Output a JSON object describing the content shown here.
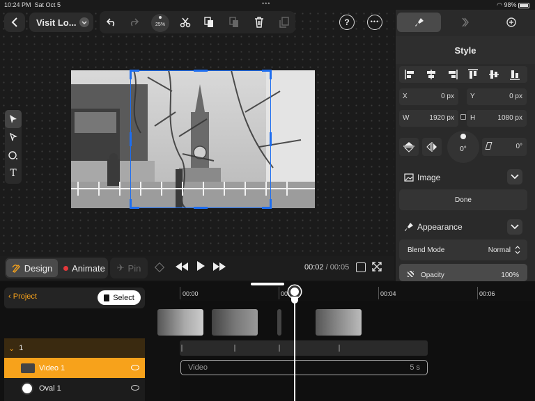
{
  "status_bar": {
    "time": "10:24 PM",
    "date": "Sat Oct 5",
    "battery": "98%"
  },
  "toolbar": {
    "project_title": "Visit Lo...",
    "zoom": "25%"
  },
  "tools": [
    "select-arrow",
    "pen",
    "oval",
    "text"
  ],
  "mode": {
    "design_label": "Design",
    "animate_label": "Animate",
    "pin_label": "Pin"
  },
  "playback": {
    "current": "00:02",
    "separator": "/",
    "total": "00:05"
  },
  "inspector": {
    "panel_title": "Style",
    "x_label": "X",
    "x_value": "0 px",
    "y_label": "Y",
    "y_value": "0 px",
    "w_label": "W",
    "w_value": "1920 px",
    "h_label": "H",
    "h_value": "1080 px",
    "rotation": "0°",
    "skew": "0°",
    "image_section": "Image",
    "done_label": "Done",
    "appearance_section": "Appearance",
    "blend_label": "Blend Mode",
    "blend_value": "Normal",
    "opacity_label": "Opacity",
    "opacity_value": "100%"
  },
  "timeline": {
    "back_label": "Project",
    "select_label": "Select",
    "ticks": [
      "00:00",
      "00:02",
      "00:04",
      "00:06"
    ],
    "group_label": "1",
    "layers": [
      {
        "name": "Video 1",
        "selected": true
      },
      {
        "name": "Oval 1",
        "selected": false
      }
    ],
    "clip_label": "Video",
    "clip_duration": "5 s"
  },
  "colors": {
    "accent": "#f7a21b",
    "selection": "#1e6ef0",
    "record": "#e5383b"
  }
}
